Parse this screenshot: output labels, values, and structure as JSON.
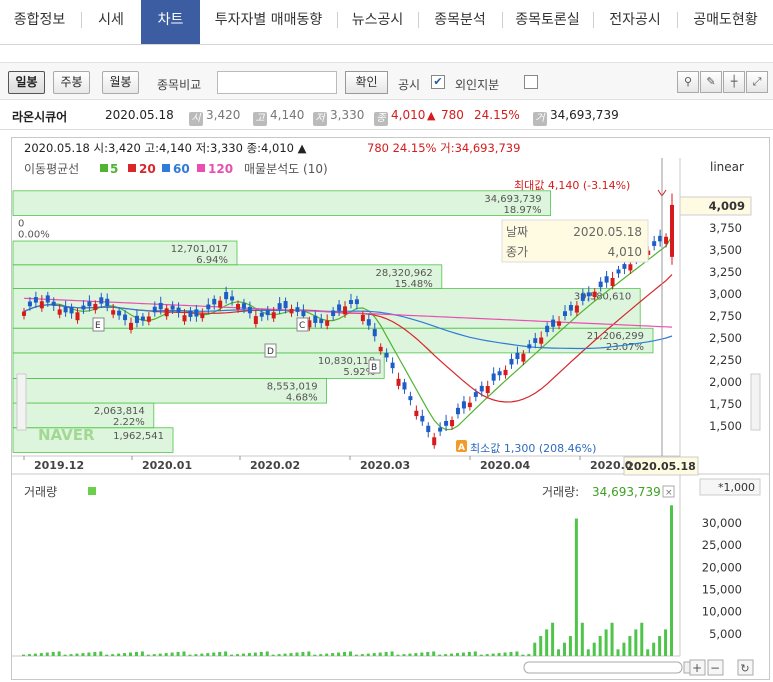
{
  "tabs": [
    {
      "label": "종합정보",
      "active": false
    },
    {
      "label": "시세",
      "active": false
    },
    {
      "label": "차트",
      "active": true
    },
    {
      "label": "투자자별 매매동향",
      "active": false
    },
    {
      "label": "뉴스공시",
      "active": false
    },
    {
      "label": "종목분석",
      "active": false
    },
    {
      "label": "종목토론실",
      "active": false
    },
    {
      "label": "전자공시",
      "active": false
    },
    {
      "label": "공매도현황",
      "active": false
    }
  ],
  "toolbar": {
    "periods": [
      "일봉",
      "주봉",
      "월봉"
    ],
    "active_period": "일봉",
    "compare_label": "종목비교",
    "compare_value": "",
    "confirm_label": "확인",
    "disclosure_label": "공시",
    "disclosure_checked": true,
    "foreign_label": "외인지분",
    "foreign_checked": false,
    "tool_icons": [
      "draw-tool-icon",
      "pen-icon",
      "crosshair-icon",
      "expand-icon"
    ]
  },
  "info": {
    "name": "라온시큐어",
    "date": "2020.05.18",
    "open_tag": "시",
    "open": "3,420",
    "high_tag": "고",
    "high": "4,140",
    "low_tag": "저",
    "low": "3,330",
    "close_tag": "종",
    "close": "4,010",
    "change_arrow": "▲",
    "change": "780",
    "change_pct": "24.15%",
    "volume_tag": "거",
    "volume": "34,693,739"
  },
  "chart_header": {
    "line": "2020.05.18 시:3,420 고:4,140 저:3,330 종:4,010 ▲",
    "change": "780 24.15% 거:34,693,739",
    "scale": "linear"
  },
  "legend": {
    "label": "이동평균선",
    "ma": [
      {
        "name": "5",
        "color": "#4fb430"
      },
      {
        "name": "20",
        "color": "#d8262b"
      },
      {
        "name": "60",
        "color": "#2f7bd8"
      },
      {
        "name": "120",
        "color": "#e94fb0"
      }
    ],
    "volume_profile_label": "매물분석도 (10)"
  },
  "annotations": {
    "max_label": "최대값 4,140 (-3.14%)",
    "min_label": "최소값 1,300 (208.46%)",
    "min_badge": "A",
    "current_price_tag": "4,009",
    "markers": [
      "E",
      "D",
      "C",
      "B"
    ],
    "date_tag": "2020.05.18",
    "watermark": "NAVER"
  },
  "tooltip": {
    "date_label": "날짜",
    "date": "2020.05.18",
    "close_label": "종가",
    "close": "4,010"
  },
  "volume_profile": [
    {
      "vol": "1,962,541",
      "pct": "",
      "price_lo": 1200,
      "price_hi": 1480,
      "len": 0.25
    },
    {
      "vol": "2,063,814",
      "pct": "2.22%",
      "price_lo": 1480,
      "price_hi": 1760,
      "len": 0.22
    },
    {
      "vol": "8,553,019",
      "pct": "4.68%",
      "price_lo": 1760,
      "price_hi": 2040,
      "len": 0.49
    },
    {
      "vol": "10,830,118",
      "pct": "5.92%",
      "price_lo": 2040,
      "price_hi": 2330,
      "len": 0.58
    },
    {
      "vol": "21,206,299",
      "pct": "23.07%",
      "price_lo": 2330,
      "price_hi": 2610,
      "len": 1.0
    },
    {
      "vol": "39,580,610",
      "pct": "",
      "price_lo": 2610,
      "price_hi": 3060,
      "len": 0.98
    },
    {
      "vol": "28,320,962",
      "pct": "15.48%",
      "price_lo": 3060,
      "price_hi": 3330,
      "len": 0.67
    },
    {
      "vol": "12,701,017",
      "pct": "6.94%",
      "price_lo": 3330,
      "price_hi": 3600,
      "len": 0.35
    },
    {
      "vol": "0",
      "pct": "0.00%",
      "price_lo": 3600,
      "price_hi": 3890,
      "len": 0.0
    },
    {
      "vol": "34,693,739",
      "pct": "18.97%",
      "price_lo": 3890,
      "price_hi": 4170,
      "len": 0.84
    }
  ],
  "volume_panel": {
    "title": "거래량",
    "current_label": "거래량:",
    "current_value": "34,693,739",
    "unit": "*1,000",
    "y_ticks": [
      "30,000",
      "25,000",
      "20,000",
      "15,000",
      "10,000",
      "5,000"
    ]
  },
  "chart_data": {
    "type": "candlestick",
    "price_y_ticks": [
      4009,
      3750,
      3500,
      3250,
      3000,
      2750,
      2500,
      2250,
      2000,
      1750,
      1500
    ],
    "price_y_tick_labels": [
      "4,009",
      "3,750",
      "3,500",
      "3,250",
      "3,000",
      "2,750",
      "2,500",
      "2,250",
      "2,000",
      "1,750",
      "1,500"
    ],
    "x_ticks": [
      "2019.12",
      "2020.01",
      "2020.02",
      "2020.03",
      "2020.04",
      "2020.05"
    ],
    "x_label_2020_05_short": "2020.0",
    "key_points": [
      {
        "date": "2020.03.19",
        "close": 1300,
        "label": "min"
      },
      {
        "date": "2020.05.18",
        "open": 3420,
        "high": 4140,
        "low": 3330,
        "close": 4010,
        "volume": 34693739
      }
    ],
    "volume_peaks_thousands": [
      {
        "date": "2020.04",
        "value": 31000
      },
      {
        "date": "2020.05.18",
        "value": 34693
      }
    ]
  }
}
